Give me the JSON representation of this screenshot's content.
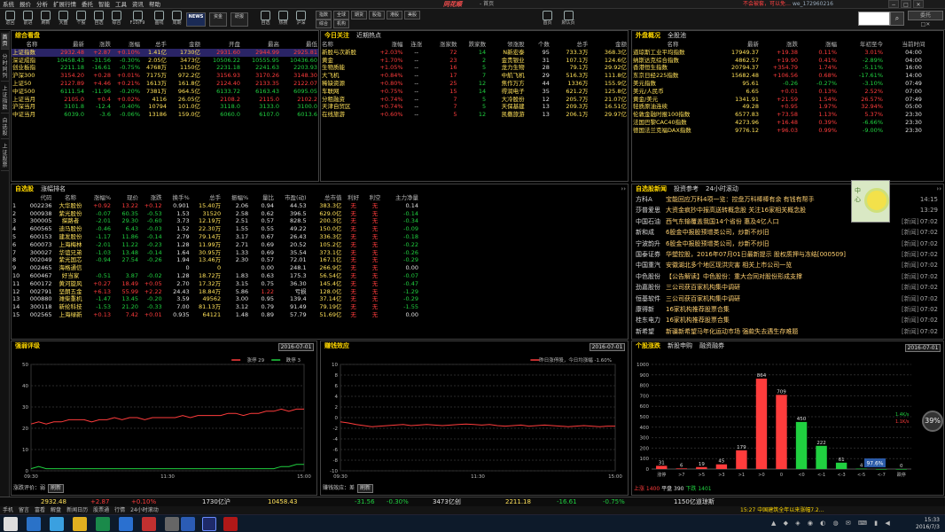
{
  "menubar": {
    "items": [
      "系统",
      "报价",
      "分析",
      "扩展行情",
      "委托",
      "智能",
      "工具",
      "资讯",
      "帮助"
    ],
    "brand": "同花顺",
    "page": "- 首页",
    "warn": "不会被套，可以免…",
    "user": "we_172960216",
    "win": [
      "−",
      "□",
      "✕"
    ]
  },
  "toolbar": {
    "items": [
      "返回",
      "前进",
      "刷新",
      "大盘",
      "个股",
      "自选",
      "综合",
      "F10/F9",
      "画线",
      "周期",
      "NEWS",
      "资金",
      "研报",
      "自选",
      "热搜",
      "沪深",
      "指数",
      "全球",
      "期货",
      "股指",
      "港股",
      "美股",
      "综合",
      "机构",
      "首页",
      "默认页"
    ],
    "search_btn": "⌕",
    "extra": [
      "委托",
      "□✕"
    ]
  },
  "sidetabs": [
    "首页",
    "分时同列",
    "上证指数",
    "自选股",
    "上证股票"
  ],
  "composite": {
    "title": "综合看盘",
    "headers": [
      "名称",
      "最新",
      "涨跌",
      "涨幅",
      "总手",
      "金额",
      "开盘",
      "最高",
      "最低"
    ],
    "rows": [
      [
        "上证指数",
        "2932.48",
        "+2.87",
        "+0.10%",
        "1.41亿",
        "1730亿",
        "2931.60",
        "2944.99",
        "2925.81"
      ],
      [
        "深证成指",
        "10458.43",
        "-31.56",
        "-0.30%",
        "2.05亿",
        "3473亿",
        "10506.22",
        "10555.95",
        "10436.60"
      ],
      [
        "创业板指",
        "2211.18",
        "-16.61",
        "-0.75%",
        "4768万",
        "1150亿",
        "2231.18",
        "2241.63",
        "2203.93"
      ],
      [
        "沪深300",
        "3154.20",
        "+0.28",
        "+0.01%",
        "7175万",
        "972.2亿",
        "3156.93",
        "3170.26",
        "3148.30"
      ],
      [
        "上证50",
        "2127.89",
        "+4.46",
        "+0.21%",
        "1613万",
        "161.8亿",
        "2124.40",
        "2133.35",
        "2122.07"
      ],
      [
        "中证500",
        "6111.54",
        "-11.96",
        "-0.20%",
        "7381万",
        "964.5亿",
        "6133.72",
        "6163.43",
        "6095.05"
      ],
      [
        "上证当月",
        "2105.0",
        "+0.4",
        "+0.02%",
        "4116",
        "26.05亿",
        "2108.2",
        "2115.0",
        "2102.2"
      ],
      [
        "沪深当月",
        "3101.8",
        "-12.4",
        "-0.40%",
        "10794",
        "101.0亿",
        "3118.0",
        "3133.0",
        "3100.0"
      ],
      [
        "中证当月",
        "6039.0",
        "-3.6",
        "-0.06%",
        "13186",
        "159.0亿",
        "6060.0",
        "6107.0",
        "6013.6"
      ]
    ]
  },
  "hot": {
    "title": "今日关注",
    "tab": "近期热点",
    "headers": [
      "名称",
      "涨幅",
      "连涨",
      "涨家数",
      "跌家数",
      "领涨股",
      "个数",
      "总手",
      "金额"
    ],
    "rows": [
      [
        "新股与次新股",
        "+2.03%",
        "--",
        "72",
        "14",
        "N新宏泰",
        "95",
        "733.3万",
        "368.3亿"
      ],
      [
        "黄金",
        "+1.70%",
        "--",
        "23",
        "2",
        "金贵银业",
        "31",
        "107.1万",
        "124.6亿"
      ],
      [
        "生物质能",
        "+1.05%",
        "--",
        "16",
        "5",
        "龙力生物",
        "28",
        "79.1万",
        "29.92亿"
      ],
      [
        "大飞机",
        "+0.84%",
        "--",
        "17",
        "7",
        "中航飞机",
        "29",
        "516.3万",
        "111.8亿"
      ],
      [
        "稀缺资源",
        "+0.80%",
        "--",
        "25",
        "12",
        "焦作万方",
        "44",
        "1336万",
        "155.9亿"
      ],
      [
        "车联网",
        "+0.75%",
        "--",
        "15",
        "14",
        "得润电子",
        "35",
        "621.2万",
        "125.8亿"
      ],
      [
        "分租融资",
        "+0.74%",
        "--",
        "7",
        "5",
        "大冷股份",
        "12",
        "205.7万",
        "21.07亿"
      ],
      [
        "天津自贸区",
        "+0.74%",
        "--",
        "7",
        "5",
        "天保基建",
        "13",
        "209.3万",
        "16.51亿"
      ],
      [
        "在线旅游",
        "+0.60%",
        "--",
        "5",
        "12",
        "凯撒旅游",
        "13",
        "206.1万",
        "29.97亿"
      ]
    ]
  },
  "overseas": {
    "title": "外盘概况",
    "tab": "全股池",
    "headers": [
      "名称",
      "最新",
      "涨跌",
      "涨幅",
      "年初至今",
      "当前时间"
    ],
    "rows": [
      [
        "道琼斯工业平均指数",
        "17949.37",
        "+19.38",
        "0.11%",
        "3.01%",
        "04:00"
      ],
      [
        "纳斯达克综合指数",
        "4862.57",
        "+19.90",
        "0.41%",
        "-2.89%",
        "04:00"
      ],
      [
        "香港恒生指数",
        "20794.37",
        "+354.79",
        "1.74%",
        "-5.11%",
        "16:00"
      ],
      [
        "东京日经225指数",
        "15682.48",
        "+106.56",
        "0.68%",
        "-17.61%",
        "14:00"
      ],
      [
        "美元指数",
        "95.61",
        "-0.26",
        "-0.27%",
        "-3.10%",
        "07:49"
      ],
      [
        "美元/人民币",
        "6.65",
        "+0.01",
        "0.13%",
        "2.52%",
        "07:00"
      ],
      [
        "黄金/美元",
        "1341.91",
        "+21.59",
        "1.54%",
        "26.57%",
        "07:49"
      ],
      [
        "轻质原油连续",
        "49.28",
        "+0.95",
        "1.97%",
        "32.94%",
        "05:00"
      ],
      [
        "伦敦金融时报100指数",
        "6577.83",
        "+73.58",
        "1.13%",
        "5.37%",
        "23:30"
      ],
      [
        "法国巴黎CAC40指数",
        "4273.96",
        "+16.48",
        "0.39%",
        "-6.66%",
        "23:30"
      ],
      [
        "德国法兰克福DAX指数",
        "9776.12",
        "+96.03",
        "0.99%",
        "-9.00%",
        "23:30"
      ]
    ]
  },
  "watch": {
    "title": "自选股",
    "tab": "涨幅排名",
    "headers": [
      "",
      "代码",
      "名称",
      "涨幅%",
      "现价",
      "涨跌",
      "换手%",
      "总手",
      "振幅%",
      "量比",
      "市盈(动)",
      "总市值",
      "利好",
      "利空",
      "主力净量"
    ],
    "rows": [
      [
        "1",
        "002236",
        "大华股份",
        "+0.92",
        "13.22",
        "+0.12",
        "0.901",
        "15.40万",
        "2.06",
        "0.94",
        "44.53",
        "383.3亿",
        "无",
        "无",
        "0.14"
      ],
      [
        "2",
        "000938",
        "紫光股份",
        "-0.07",
        "60.35",
        "-0.53",
        "1.53",
        "31520",
        "2.58",
        "0.62",
        "396.5",
        "629.0亿",
        "无",
        "无",
        "-0.14"
      ],
      [
        "3",
        "300005",
        "探路者",
        "-2.01",
        "29.30",
        "-0.60",
        "3.73",
        "12.19万",
        "2.51",
        "0.57",
        "828.5",
        "200.3亿",
        "无",
        "无",
        "-0.34"
      ],
      [
        "4",
        "600565",
        "迪马股份",
        "-0.46",
        "6.43",
        "-0.03",
        "1.52",
        "22.30万",
        "1.55",
        "0.55",
        "49.22",
        "150.0亿",
        "无",
        "无",
        "-0.09"
      ],
      [
        "5",
        "600153",
        "建发股份",
        "-1.17",
        "11.86",
        "-0.14",
        "2.79",
        "79.14万",
        "3.17",
        "0.67",
        "26.43",
        "336.3亿",
        "无",
        "无",
        "-0.18"
      ],
      [
        "6",
        "600073",
        "上海梅林",
        "-2.01",
        "11.22",
        "-0.23",
        "1.28",
        "11.99万",
        "2.71",
        "0.69",
        "20.52",
        "105.2亿",
        "无",
        "无",
        "-0.22"
      ],
      [
        "7",
        "300027",
        "华谊兄弟",
        "-1.03",
        "13.48",
        "-0.14",
        "1.64",
        "30.95万",
        "1.33",
        "0.69",
        "35.54",
        "373.1亿",
        "无",
        "无",
        "-0.26"
      ],
      [
        "8",
        "002049",
        "紫光国芯",
        "-0.94",
        "27.54",
        "-0.26",
        "1.94",
        "13.46万",
        "2.30",
        "0.57",
        "72.01",
        "167.1亿",
        "无",
        "无",
        "-0.29"
      ],
      [
        "9",
        "002465",
        "海格通信",
        "",
        "",
        "",
        "0",
        "0",
        "",
        "0.00",
        "248.1",
        "266.9亿",
        "无",
        "无",
        "0.00"
      ],
      [
        "10",
        "600467",
        "好当家",
        "-0.51",
        "3.87",
        "-0.02",
        "1.28",
        "18.72万",
        "1.83",
        "0.63",
        "175.3",
        "56.54亿",
        "无",
        "无",
        "-0.07"
      ],
      [
        "11",
        "600172",
        "黄河旋风",
        "+0.27",
        "18.49",
        "+0.05",
        "2.70",
        "17.32万",
        "3.15",
        "0.75",
        "36.30",
        "145.4亿",
        "无",
        "无",
        "-0.47"
      ],
      [
        "12",
        "002791",
        "坚朗五金",
        "+6.13",
        "55.99",
        "+2.22",
        "24.43",
        "18.84万",
        "5.86",
        "1.22",
        "亏损",
        "128.0亿",
        "无",
        "无",
        "-1.29"
      ],
      [
        "13",
        "000880",
        "潍柴重机",
        "-1.47",
        "13.45",
        "-0.20",
        "3.59",
        "49562",
        "3.00",
        "0.95",
        "139.4",
        "37.14亿",
        "无",
        "无",
        "-0.29"
      ],
      [
        "14",
        "300118",
        "新纶科技",
        "-1.53",
        "21.20",
        "-0.33",
        "7.00",
        "81.13万",
        "3.12",
        "0.79",
        "91.49",
        "79.19亿",
        "无",
        "无",
        "-1.55"
      ],
      [
        "15",
        "002565",
        "上海绿新",
        "+0.13",
        "7.42",
        "+0.01",
        "0.935",
        "64121",
        "1.48",
        "0.89",
        "57.79",
        "51.69亿",
        "无",
        "无",
        "0.00"
      ]
    ]
  },
  "news": {
    "title": "自选股新闻",
    "tabs": [
      "投资参考",
      "24小时滚动"
    ],
    "rows": [
      [
        "方科A",
        "宝能回应万科4项一览：控盘万科棒棒有余 有钱有帮手",
        "",
        "14:15"
      ],
      [
        "莎普爱思",
        "大资金疯抄中报高送转概念股 关注16家相关概念股",
        "",
        "13:29"
      ],
      [
        "中国石油",
        "西气东输覆盖我国14个省份 惠及4亿人口",
        "[新闻]",
        "07:02"
      ],
      [
        "新和成",
        "6股金中报股预增类公司，炒新不炒旧",
        "[新闻]",
        "07:02"
      ],
      [
        "宁波韵升",
        "6股金中报股预增类公司，炒新不炒旧",
        "[新闻]",
        "07:02"
      ],
      [
        "国泰证券",
        "华塑控股，2016年07月01日最新提示 股权质押与冻结[000509]",
        "[新闻]",
        "07:02"
      ],
      [
        "中国重汽",
        "安徽湖北多个地区现洪灾害 相关上市公司一览",
        "[新闻]",
        "07:02"
      ],
      [
        "中色股份",
        "【公告解读】中色股份：重大合同对股份形成支撑",
        "[新闻]",
        "07:02"
      ],
      [
        "劲嘉股份",
        "三公司获百家机构集中调研",
        "[新闻]",
        "07:02"
      ],
      [
        "恒基软件",
        "三公司获百家机构集中调研",
        "[新闻]",
        "07:02"
      ],
      [
        "康得新",
        "16家机构推荐股票合集",
        "[新闻]",
        "07:02"
      ],
      [
        "桂东电力",
        "16家机构推荐股票合集",
        "[新闻]",
        "07:02"
      ],
      [
        "新希望",
        "新疆新希望马年化运动市场 强款失去遇生存难题",
        "[新闻]",
        "07:02"
      ]
    ]
  },
  "ad": {
    "text": "中心"
  },
  "chart_data": [
    {
      "type": "line",
      "title": "强弱评级",
      "date": "2016-07-01",
      "legend": [
        "涨停 29",
        "跌停 3"
      ],
      "ylim": [
        0,
        50
      ],
      "yticks": [
        0,
        10,
        20,
        30,
        40,
        50
      ],
      "xticks": [
        "09:30",
        "11:30",
        "15:00"
      ],
      "series": [
        {
          "name": "涨停",
          "color": "#ff3c3c",
          "values": [
            22,
            23,
            22,
            23,
            23,
            24,
            24,
            24,
            23,
            24,
            24,
            25,
            24,
            25,
            25,
            24,
            25,
            25,
            25,
            25,
            26,
            25,
            26,
            26,
            26,
            26,
            27,
            27,
            26,
            27,
            27,
            28,
            28,
            29,
            28,
            29,
            29
          ]
        },
        {
          "name": "跌停",
          "color": "#20d040",
          "values": [
            1,
            2,
            1,
            1,
            1,
            1,
            1,
            1,
            1,
            1,
            1,
            1,
            1,
            1,
            1,
            1,
            1,
            1,
            1,
            1,
            1,
            1,
            1,
            1,
            1,
            1,
            1,
            1,
            1,
            1,
            1,
            1,
            1,
            2,
            2,
            3,
            3
          ]
        }
      ],
      "footer": "涨跌评价：弱",
      "footer_btn": "刷新"
    },
    {
      "type": "line",
      "title": "赚钱效应",
      "date": "2016-07-01",
      "legend": [
        "昨日涨停股，今日均涨幅 -1.60%"
      ],
      "ylim": [
        -10,
        10
      ],
      "yticks": [
        -10,
        -8,
        -6,
        -4,
        -2,
        0,
        2,
        4,
        6,
        8,
        10
      ],
      "xticks": [
        "09:30",
        "11:30",
        "15:00"
      ],
      "series": [
        {
          "name": "昨日涨停股今日均涨幅",
          "color": "#ff3c3c",
          "values": [
            -0.8,
            -1.0,
            -1.3,
            -1.5,
            -1.7,
            -1.6,
            -1.5,
            -1.4,
            -1.3,
            -1.5,
            -1.4,
            -1.3,
            -1.4,
            -1.5,
            -1.4,
            -1.3,
            -1.2,
            -1.3,
            -1.4,
            -1.3,
            -1.5,
            -1.6,
            -1.5,
            -1.4,
            -1.6,
            -1.5,
            -1.4,
            -1.5,
            -1.6,
            -1.7,
            -1.6,
            -1.5,
            -1.6,
            -1.7,
            -1.6,
            -1.6
          ]
        }
      ],
      "footer": "赚钱效应：差",
      "footer_btn": "刷新"
    },
    {
      "type": "bar",
      "title": "个股涨跌",
      "tabs": [
        "新股申购",
        "融资融券"
      ],
      "date": "2016-07-01",
      "ylim": [
        0,
        1000
      ],
      "yticks": [
        0,
        100,
        200,
        300,
        400,
        500,
        600,
        700,
        800,
        900,
        1000
      ],
      "categories": [
        "涨停",
        ">7",
        ">5",
        ">3",
        ">1",
        ">0",
        "0",
        "<0",
        "<-1",
        "<-3",
        "<-5",
        "<-7",
        "跌停"
      ],
      "values": [
        31,
        6,
        19,
        45,
        179,
        864,
        709,
        450,
        222,
        61,
        4,
        0,
        0
      ],
      "colors": [
        "#ff3c3c",
        "#ff3c3c",
        "#ff3c3c",
        "#ff3c3c",
        "#ff3c3c",
        "#ff3c3c",
        "#ff3c3c",
        "#20d040",
        "#20d040",
        "#20d040",
        "#20d040",
        "#20d040",
        "#20d040"
      ],
      "footer": {
        "up": "上涨 1400",
        "flat": "平盘 390",
        "down": "下跌 1401"
      },
      "pct": "97.6%"
    }
  ],
  "gauge": {
    "value": "39%",
    "net_up": "1.4K/s",
    "net_down": "1.1K/s"
  },
  "statusbar": {
    "items": [
      [
        "2932.48",
        "yl"
      ],
      [
        "+2.87",
        "up"
      ],
      [
        "+0.10%",
        "up"
      ],
      [
        "1730亿沪",
        "wh"
      ],
      [
        "10458.43",
        "yl"
      ],
      [
        "-31.56",
        "dn"
      ],
      [
        "-0.30%",
        "dn"
      ],
      [
        "3473亿创",
        "wh"
      ],
      [
        "2211.18",
        "yl"
      ],
      [
        "-16.61",
        "dn"
      ],
      [
        "-0.75%",
        "dn"
      ],
      [
        "1150亿道琼斯",
        "wh"
      ]
    ]
  },
  "statusbar2": {
    "items": [
      "手机",
      "留言",
      "富看",
      "解盘",
      "新闻日历",
      "股票通",
      "行情",
      "24小时滚动"
    ],
    "ticker": "15:27 中国建筑全年以来涨幅7.2…"
  },
  "taskbar": {
    "time": "15:33",
    "date": "2016/7/3"
  }
}
